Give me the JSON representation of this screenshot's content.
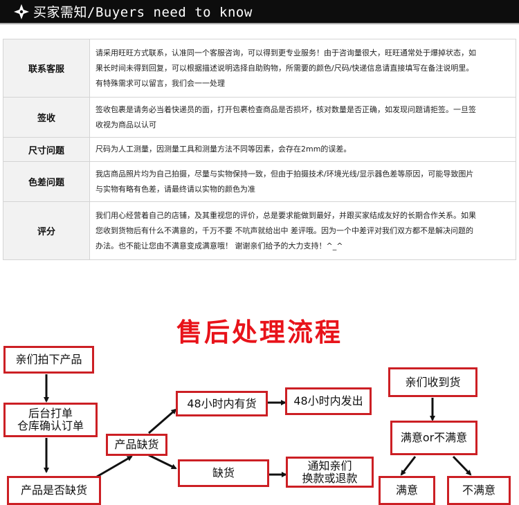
{
  "header": {
    "title": "买家需知/Buyers need to know"
  },
  "info_rows": [
    {
      "label": "联系客服",
      "lines": [
        "请采用旺旺方式联系，认准同一个客服咨询，可以得到更专业服务！由于咨询量很大，旺旺通常处于爆掉状态，如",
        "果长时间未得到回复，可以根据描述说明选择自助购物，所需要的颜色/尺码/快递信息请直接填写在备注说明里。",
        "有特殊需求可以留言，我们会一一处理"
      ]
    },
    {
      "label": "签收",
      "lines": [
        "签收包裹是请务必当着快递员的面，打开包裹检查商品是否损坏，核对数量是否正确，如发现问题请拒签。一旦签",
        "收视为商品以认可"
      ]
    },
    {
      "label": "尺寸问题",
      "lines": [
        "尺码为人工测量，因测量工具和测量方法不同等因素，会存在2mm的误差。"
      ]
    },
    {
      "label": "色差问题",
      "lines": [
        "我店商品照片均为自己拍摄，尽量与实物保持一致，但由于拍摄技术/环境光线/显示器色差等原因，可能导致图片",
        "与实物有略有色差，请最终请以实物的颜色为准"
      ]
    },
    {
      "label": "评分",
      "lines": [
        "我们用心经营着自己的店铺，及其重视您的评价，总是要求能做到最好，并跟买家结成友好的长期合作关系。如果",
        "您收到货物后有什么不满意的，千万不要 不吭声就给出中 差评哦。因为一个中差评对我们双方都不是解决问题的",
        "办法。也不能让您由不满意变成满意哦！ 谢谢亲们给予的大力支持！^_^"
      ]
    }
  ],
  "flow": {
    "title": "售后处理流程",
    "boxes": {
      "order": "亲们拍下产品",
      "backend_line1": "后台打单",
      "backend_line2": "仓库确认订单",
      "is_out_of_stock": "产品是否缺货",
      "product_shortage": "产品缺货",
      "in_stock_48h": "48小时内有货",
      "ship_48h": "48小时内发出",
      "out_of_stock": "缺货",
      "notify_line1": "通知亲们",
      "notify_line2": "换款或退款",
      "received": "亲们收到货",
      "satisfied_or_not": "满意or不满意",
      "satisfied": "满意",
      "not_satisfied": "不满意"
    }
  },
  "colors": {
    "header_bg": "#0d0d0d",
    "accent_red": "#e8131a",
    "box_border": "#cc1f24",
    "label_bg": "#f2f2f2"
  }
}
